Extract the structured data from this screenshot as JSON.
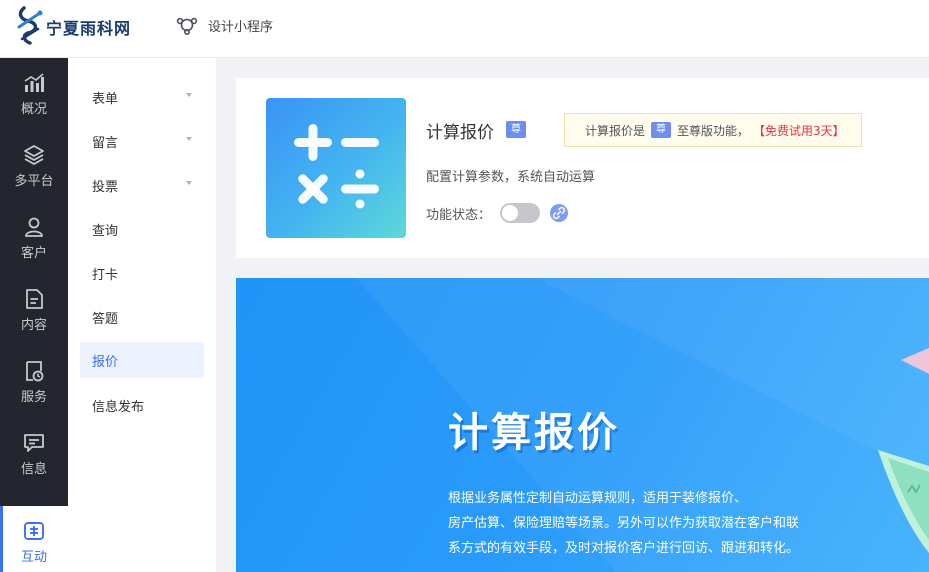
{
  "header": {
    "site_name": "宁夏雨科网",
    "mini_program_link": "设计小程序"
  },
  "rail": {
    "items": [
      {
        "label": "概况",
        "icon": "chart-bar-icon"
      },
      {
        "label": "多平台",
        "icon": "layers-icon"
      },
      {
        "label": "客户",
        "icon": "user-icon"
      },
      {
        "label": "内容",
        "icon": "document-icon"
      },
      {
        "label": "服务",
        "icon": "service-icon"
      },
      {
        "label": "信息",
        "icon": "message-icon"
      },
      {
        "label": "互动",
        "icon": "interaction-icon"
      }
    ],
    "active_index": 6
  },
  "submenu": {
    "items": [
      {
        "label": "表单",
        "has_caret": true
      },
      {
        "label": "留言",
        "has_caret": true
      },
      {
        "label": "投票",
        "has_caret": true
      },
      {
        "label": "查询",
        "has_caret": false
      },
      {
        "label": "打卡",
        "has_caret": false
      },
      {
        "label": "答题",
        "has_caret": false
      },
      {
        "label": "报价",
        "has_caret": false
      },
      {
        "label": "信息发布",
        "has_caret": false
      }
    ],
    "active_index": 6
  },
  "feature": {
    "title": "计算报价",
    "badge": "尊",
    "tip_prefix": "计算报价是",
    "tip_badge": "尊",
    "tip_suffix": "至尊版功能，",
    "tip_trial": "【免费试用3天】",
    "description": "配置计算参数，系统自动运算",
    "status_label": "功能状态：",
    "enabled": false
  },
  "banner": {
    "title": "计算报价",
    "lines": [
      "根据业务属性定制自动运算规则，适用于装修报价、",
      "房产估算、保险理赔等场景。另外可以作为获取潜在客户和联",
      "系方式的有效手段，及时对报价客户进行回访、跟进和转化。"
    ]
  },
  "colors": {
    "accent": "#3b6ff5",
    "rail_bg": "#23262e",
    "trial_red": "#e0393e",
    "banner_blue": "#2194f7"
  }
}
